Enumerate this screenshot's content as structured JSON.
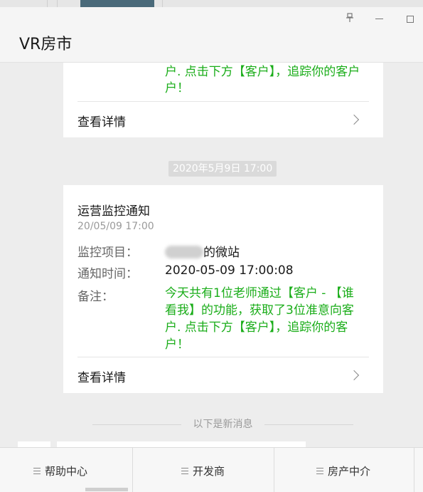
{
  "window": {
    "title": "VR房市",
    "pin_glyph": "📌"
  },
  "card_top": {
    "message_tail_line1": "户. 点击下方【客户】，追踪你的客户",
    "message_tail_line2": "户！",
    "detail_label": "查看详情"
  },
  "timestamp": "2020年5月9日 17:00",
  "card_main": {
    "title": "运营监控通知",
    "date": "20/05/09 17:00",
    "fields": [
      {
        "label": "监控项目：",
        "value": "的微站"
      },
      {
        "label": "通知时间：",
        "value": "2020-05-09 17:00:08"
      },
      {
        "label": "备注：",
        "value_lines": [
          "今天共有1位老师通过【客户 - 【谁",
          "看我】的功能，获取了3位准意向客",
          "户. 点击下方【客户】，追踪你的客",
          "户！"
        ]
      }
    ],
    "detail_label": "查看详情"
  },
  "new_messages_divider": "以下是新消息",
  "bottom_menu": [
    {
      "label": "帮助中心",
      "icon": "menu-icon"
    },
    {
      "label": "开发商",
      "icon": "menu-icon"
    },
    {
      "label": "房产中介",
      "icon": "menu-icon"
    }
  ],
  "colors": {
    "accent_green": "#1aad19",
    "background": "#ededed"
  }
}
